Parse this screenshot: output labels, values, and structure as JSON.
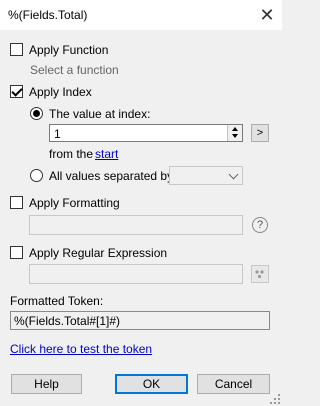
{
  "window": {
    "title": "%(Fields.Total)",
    "close_glyph": "✕"
  },
  "apply_function": {
    "label": "Apply Function",
    "checked": false,
    "hint": "Select a function"
  },
  "apply_index": {
    "label": "Apply Index",
    "checked": true,
    "value_at_index": {
      "label": "The value at index:",
      "selected": true,
      "value": "1",
      "nav_button": ">"
    },
    "from_label": "from the",
    "from_link": "start",
    "all_values": {
      "label": "All values separated by:",
      "selected": false,
      "value": ""
    }
  },
  "apply_formatting": {
    "label": "Apply Formatting",
    "checked": false,
    "value": "",
    "help_glyph": "?"
  },
  "apply_regex": {
    "label": "Apply Regular Expression",
    "checked": false,
    "value": ""
  },
  "formatted_token": {
    "label": "Formatted Token:",
    "value": "%(Fields.Total#[1]#)"
  },
  "test_link": "Click here to test the token",
  "buttons": {
    "help": "Help",
    "ok": "OK",
    "cancel": "Cancel"
  }
}
